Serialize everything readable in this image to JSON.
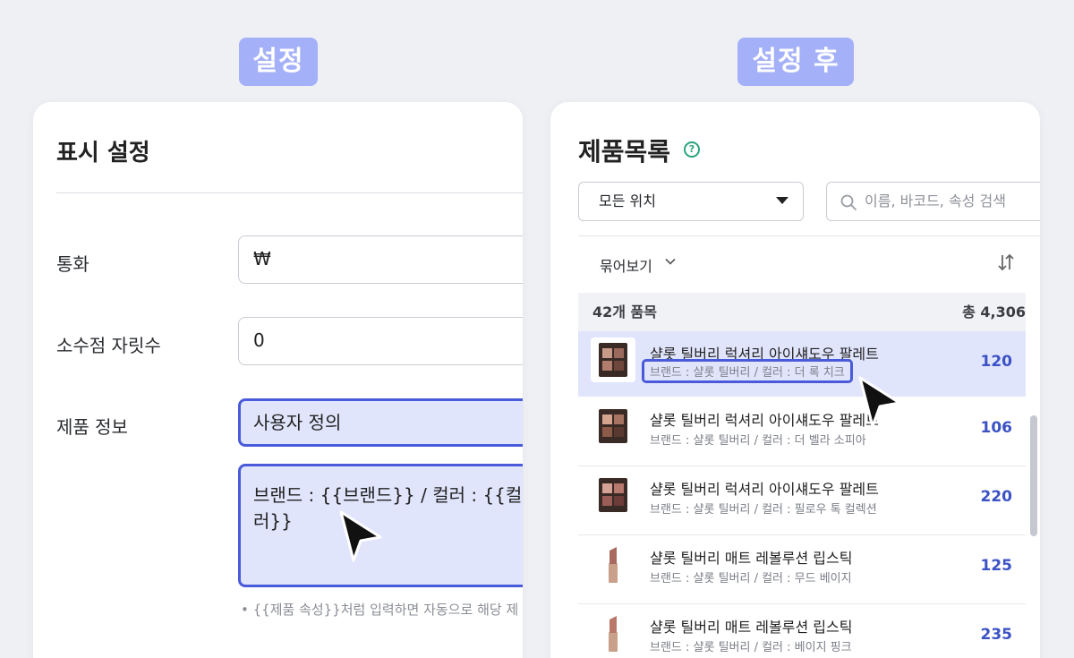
{
  "labels": {
    "left_tag": "설정",
    "right_tag": "설정 후"
  },
  "settings": {
    "title": "표시 설정",
    "rows": [
      {
        "label": "통화",
        "value": "₩"
      },
      {
        "label": "소수점 자릿수",
        "value": "0"
      },
      {
        "label": "제품 정보",
        "value": "사용자 정의"
      }
    ],
    "template_text": "브랜드 : {{브랜드}} / 컬러 : {{컬러}}",
    "hint": "• {{제품 속성}}처럼 입력하면 자동으로 해당 제"
  },
  "product_list": {
    "title": "제품목록",
    "help_icon": "?",
    "location_select": "모든 위치",
    "search_placeholder": "이름, 바코드, 속성 검색",
    "group_by": "묶어보기",
    "count_label": "42개 품목",
    "total_label": "총 4,306",
    "items": [
      {
        "name": "샬롯 틸버리 럭셔리 아이섀도우 팔레트",
        "sub": "브랜드 : 샬롯 틸버리 / 컬러 : 더 록 치크",
        "qty": "120",
        "icon": "eyeshadow-palette"
      },
      {
        "name": "샬롯 틸버리 럭셔리 아이섀도우 팔레트",
        "sub": "브랜드 : 샬롯 틸버리 / 컬러 : 더 벨라 소피아",
        "qty": "106",
        "icon": "eyeshadow-palette"
      },
      {
        "name": "샬롯 틸버리 럭셔리 아이섀도우 팔레트",
        "sub": "브랜드 : 샬롯 틸버리 / 컬러 : 필로우 톡 컬렉션",
        "qty": "220",
        "icon": "eyeshadow-palette"
      },
      {
        "name": "샬롯 틸버리 매트 레볼루션 립스틱",
        "sub": "브랜드 : 샬롯 틸버리 / 컬러 : 무드 베이지",
        "qty": "125",
        "icon": "lipstick"
      },
      {
        "name": "샬롯 틸버리 매트 레볼루션 립스틱",
        "sub": "브랜드 : 샬롯 틸버리 / 컬러 : 베이지 핑크",
        "qty": "235",
        "icon": "lipstick"
      }
    ]
  },
  "colors": {
    "accent": "#4a5bd9",
    "highlight_bg": "#e1e5fc",
    "tag_bg": "#a4b0f7",
    "qty": "#3b52c4",
    "help": "#2aa57a"
  }
}
